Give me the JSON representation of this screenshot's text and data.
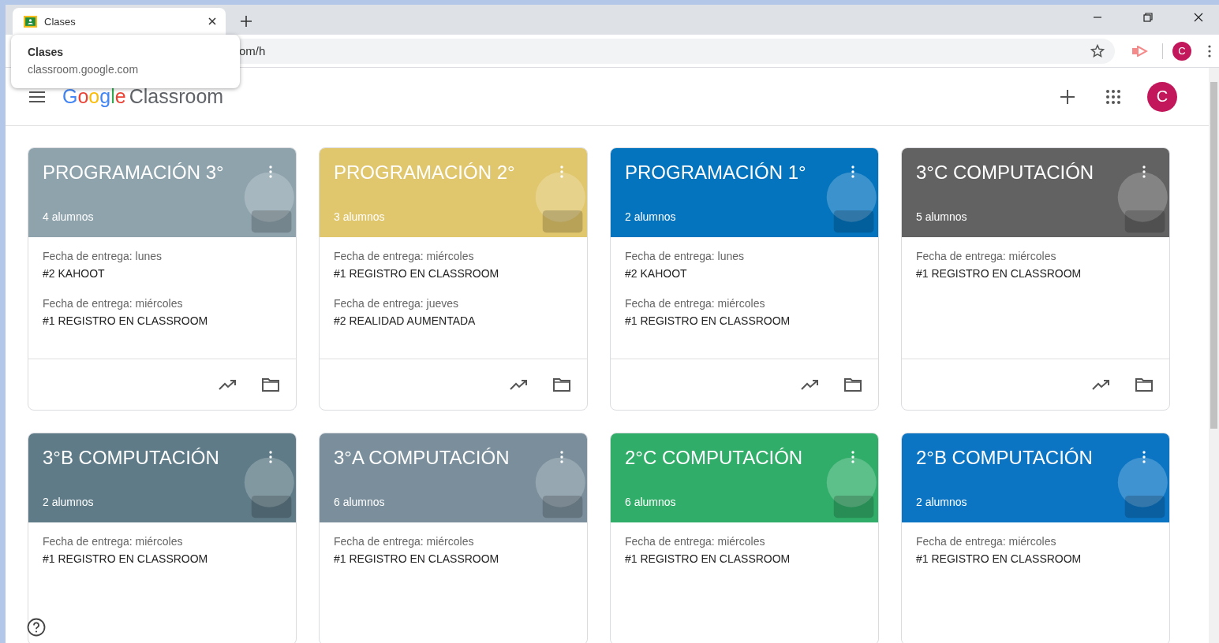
{
  "browser": {
    "tab": {
      "title": "Clases"
    },
    "address": "om/h",
    "tooltip": {
      "title": "Clases",
      "url": "classroom.google.com"
    },
    "profile_initial": "C"
  },
  "app": {
    "logo_google": "Google",
    "logo_product": "Classroom",
    "avatar_initial": "C"
  },
  "classes": [
    {
      "title": "PROGRAMACIÓN 3°",
      "students": "4 alumnos",
      "color": "#8fa3ad",
      "assignments": [
        {
          "due": "Fecha de entrega: lunes",
          "name": "#2 KAHOOT"
        },
        {
          "due": "Fecha de entrega: miércoles",
          "name": "#1 REGISTRO EN CLASSROOM"
        }
      ]
    },
    {
      "title": "PROGRAMACIÓN 2°",
      "students": "3 alumnos",
      "color": "#e0c66c",
      "assignments": [
        {
          "due": "Fecha de entrega: miércoles",
          "name": "#1 REGISTRO EN CLASSROOM"
        },
        {
          "due": "Fecha de entrega: jueves",
          "name": "#2 REALIDAD AUMENTADA"
        }
      ]
    },
    {
      "title": "PROGRAMACIÓN 1°",
      "students": "2 alumnos",
      "color": "#0474be",
      "assignments": [
        {
          "due": "Fecha de entrega: lunes",
          "name": "#2 KAHOOT"
        },
        {
          "due": "Fecha de entrega: miércoles",
          "name": "#1 REGISTRO EN CLASSROOM"
        }
      ]
    },
    {
      "title": "3°C COMPUTACIÓN",
      "students": "5 alumnos",
      "color": "#626262",
      "assignments": [
        {
          "due": "Fecha de entrega: miércoles",
          "name": "#1 REGISTRO EN CLASSROOM"
        }
      ]
    },
    {
      "title": "3°B COMPUTACIÓN",
      "students": "2 alumnos",
      "color": "#5f7b87",
      "assignments": [
        {
          "due": "Fecha de entrega: miércoles",
          "name": "#1 REGISTRO EN CLASSROOM"
        }
      ]
    },
    {
      "title": "3°A COMPUTACIÓN",
      "students": "6 alumnos",
      "color": "#7a8f9b",
      "assignments": [
        {
          "due": "Fecha de entrega: miércoles",
          "name": "#1 REGISTRO EN CLASSROOM"
        }
      ]
    },
    {
      "title": "2°C COMPUTACIÓN",
      "students": "6 alumnos",
      "color": "#30ad68",
      "assignments": [
        {
          "due": "Fecha de entrega: miércoles",
          "name": "#1 REGISTRO EN CLASSROOM"
        }
      ]
    },
    {
      "title": "2°B COMPUTACIÓN",
      "students": "2 alumnos",
      "color": "#0b75c4",
      "assignments": [
        {
          "due": "Fecha de entrega: miércoles",
          "name": "#1 REGISTRO EN CLASSROOM"
        }
      ]
    }
  ]
}
